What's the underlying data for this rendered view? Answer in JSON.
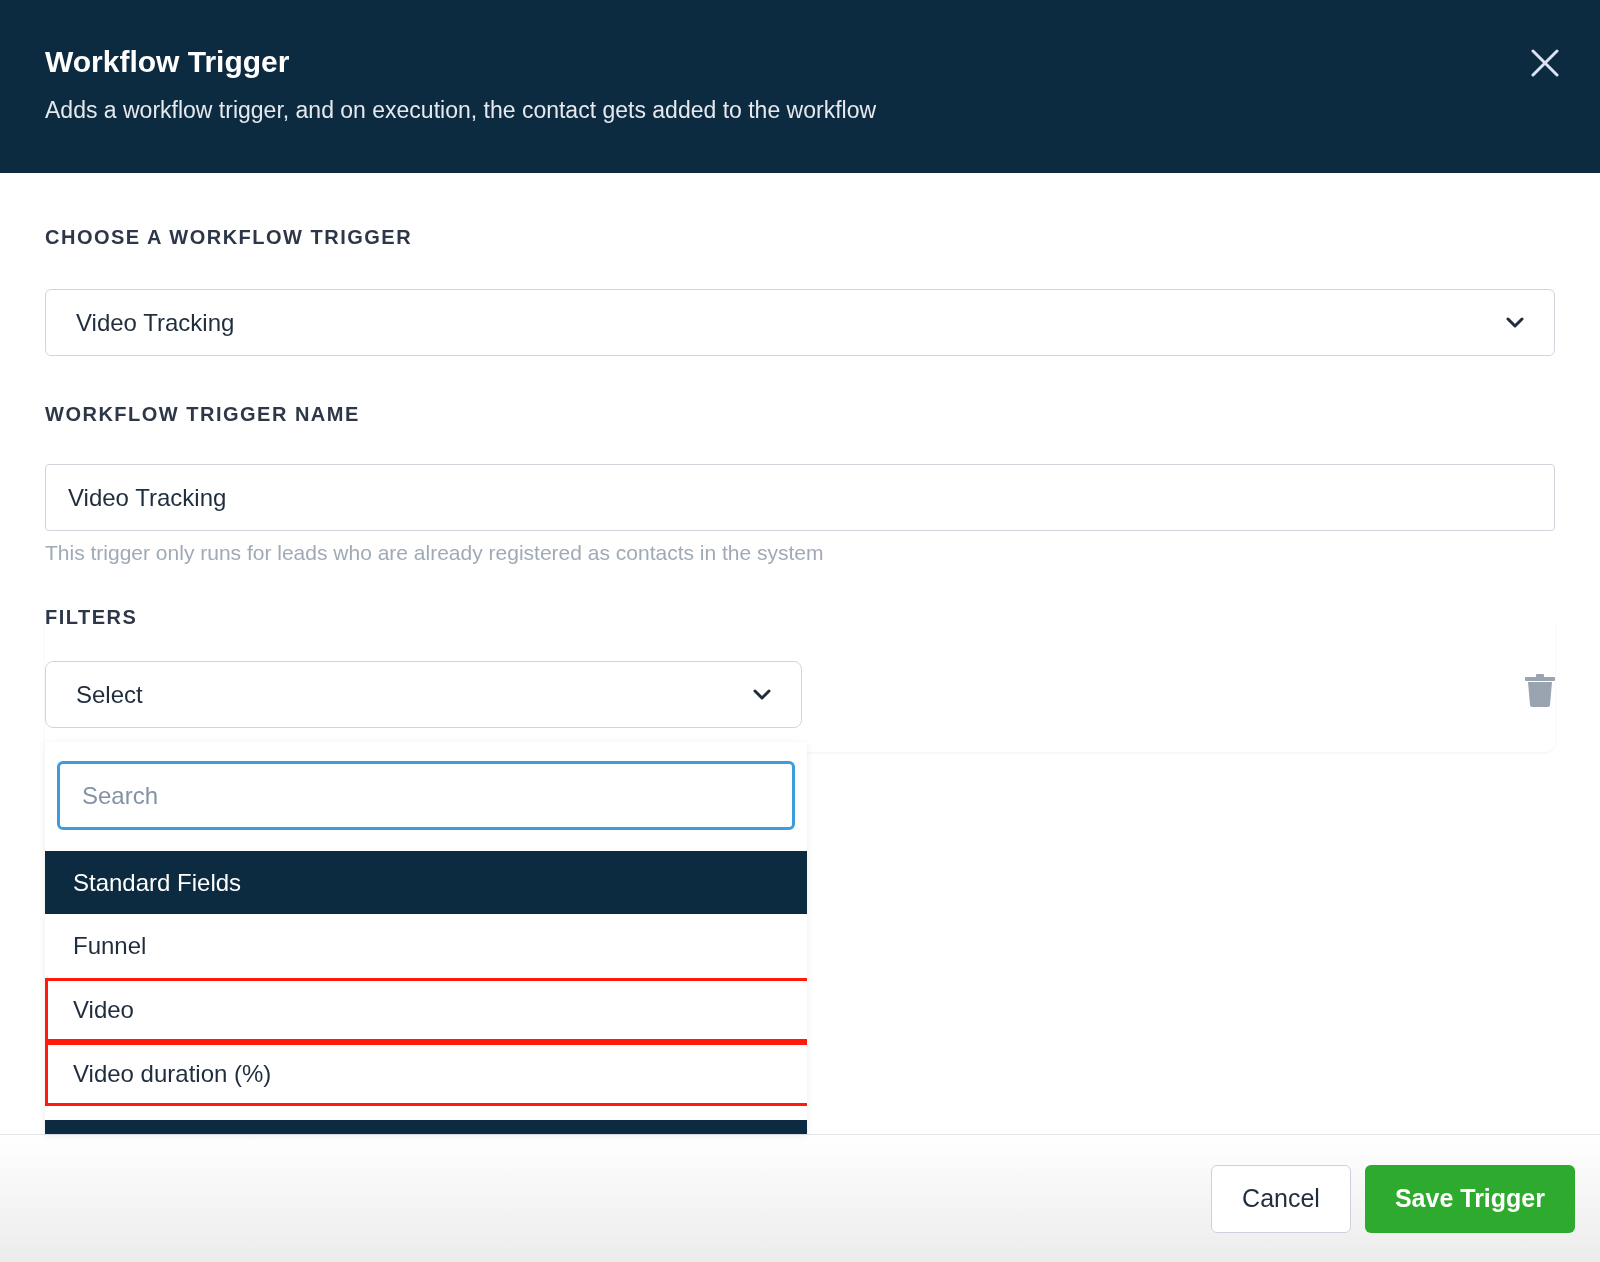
{
  "header": {
    "title": "Workflow Trigger",
    "subtitle": "Adds a workflow trigger, and on execution, the contact gets added to the workflow"
  },
  "trigger_select": {
    "label": "CHOOSE A WORKFLOW TRIGGER",
    "value": "Video Tracking"
  },
  "trigger_name": {
    "label": "WORKFLOW TRIGGER NAME",
    "value": "Video Tracking",
    "hint": "This trigger only runs for leads who are already registered as contacts in the system"
  },
  "filters": {
    "label": "FILTERS",
    "select": {
      "placeholder": "Select"
    },
    "dropdown": {
      "search": {
        "placeholder": "Search"
      },
      "items": [
        {
          "kind": "group",
          "label": "Standard Fields"
        },
        {
          "kind": "option",
          "label": "Funnel",
          "highlighted": false
        },
        {
          "kind": "option",
          "label": "Video",
          "highlighted": true
        },
        {
          "kind": "option",
          "label": "Video duration (%)",
          "highlighted": true
        },
        {
          "kind": "group"
        }
      ]
    }
  },
  "buttons": [
    {
      "kind": "secondary",
      "label": "Cancel"
    },
    {
      "kind": "primary",
      "label": "Save Trigger"
    }
  ]
}
